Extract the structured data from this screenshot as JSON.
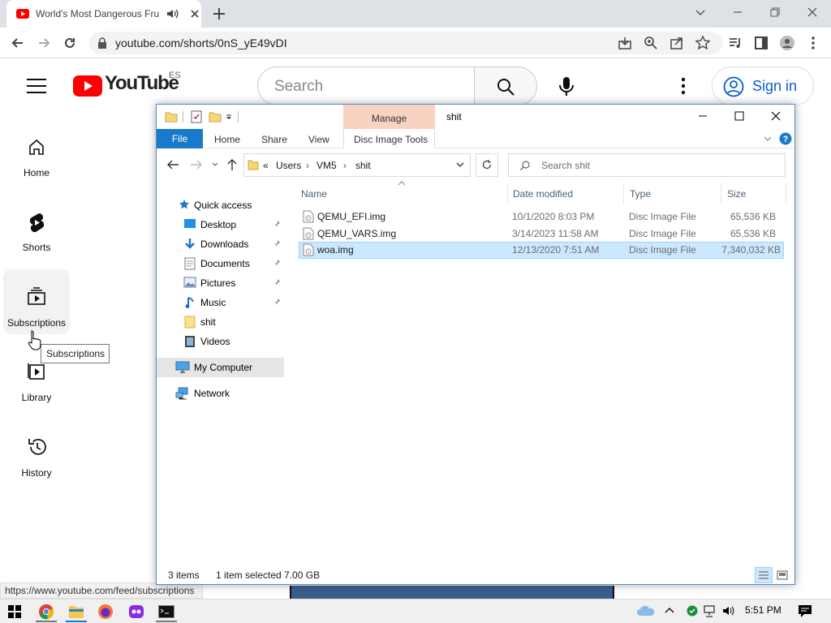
{
  "browser": {
    "tab_title": "World's Most Dangerous Fru",
    "url": "youtube.com/shorts/0nS_yE49vDI",
    "status_url": "https://www.youtube.com/feed/subscriptions"
  },
  "youtube": {
    "logo_text": "YouTube",
    "country_code": "ES",
    "search_placeholder": "Search",
    "signin_label": "Sign in",
    "nav": [
      {
        "label": "Home",
        "icon": "home-icon"
      },
      {
        "label": "Shorts",
        "icon": "shorts-icon"
      },
      {
        "label": "Subscriptions",
        "icon": "subscriptions-icon"
      },
      {
        "label": "Library",
        "icon": "library-icon"
      },
      {
        "label": "History",
        "icon": "history-icon"
      }
    ],
    "tooltip": "Subscriptions"
  },
  "explorer": {
    "title": "shit",
    "manage_label": "Manage",
    "ribbon": {
      "file": "File",
      "home": "Home",
      "share": "Share",
      "view": "View",
      "disc_tools": "Disc Image Tools"
    },
    "breadcrumb": [
      "Users",
      "VM5",
      "shit"
    ],
    "breadcrumb_prefix": "«",
    "search_placeholder": "Search shit",
    "nav_pane": {
      "quick_access": "Quick access",
      "items": [
        "Desktop",
        "Downloads",
        "Documents",
        "Pictures",
        "Music",
        "shit",
        "Videos"
      ],
      "my_computer": "My Computer",
      "network": "Network"
    },
    "columns": {
      "name": "Name",
      "date": "Date modified",
      "type": "Type",
      "size": "Size"
    },
    "files": [
      {
        "name": "QEMU_EFI.img",
        "date": "10/1/2020 8:03 PM",
        "type": "Disc Image File",
        "size": "65,536 KB"
      },
      {
        "name": "QEMU_VARS.img",
        "date": "3/14/2023 11:58 AM",
        "type": "Disc Image File",
        "size": "65,536 KB"
      },
      {
        "name": "woa.img",
        "date": "12/13/2020 7:51 AM",
        "type": "Disc Image File",
        "size": "7,340,032 KB",
        "selected": true
      }
    ],
    "status": {
      "items": "3 items",
      "selection": "1 item selected  7.00 GB"
    }
  },
  "taskbar": {
    "time": "5:51 PM"
  },
  "colors": {
    "yt_red": "#ff0000",
    "link_blue": "#065fd4",
    "ribbon_file": "#1979ca",
    "manage_bg": "#f8d3c2",
    "selection_bg": "#cce8ff"
  }
}
